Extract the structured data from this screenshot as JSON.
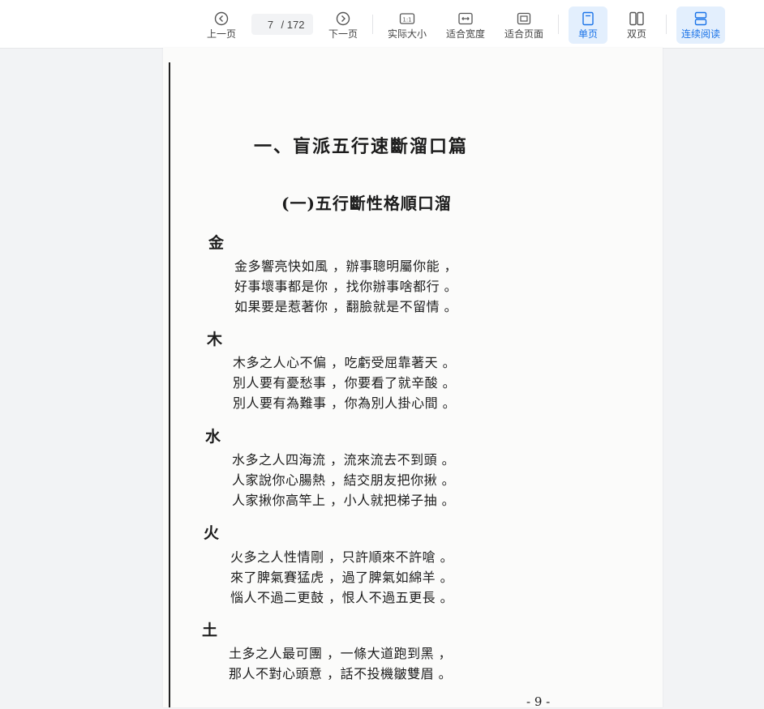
{
  "toolbar": {
    "prev_label": "上一页",
    "next_label": "下一页",
    "current_page": "7",
    "total_pages": "/ 172",
    "actual_size_label": "实际大小",
    "fit_width_label": "适合宽度",
    "fit_page_label": "适合页面",
    "single_page_label": "单页",
    "double_page_label": "双页",
    "continuous_label": "连续阅读",
    "accent_color": "#1a73e8"
  },
  "document": {
    "title": "一、盲派五行速斷溜口篇",
    "subtitle": "(一)五行斷性格順口溜",
    "sections": [
      {
        "heading": "金",
        "lines": [
          "金多響亮快如風 ，辦事聰明屬你能 ，",
          "好事壞事都是你 ，找你辦事啥都行 。",
          "如果要是惹著你 ，翻臉就是不留情 。"
        ]
      },
      {
        "heading": "木",
        "lines": [
          "木多之人心不偏 ，吃虧受屈靠著天 。",
          "別人要有憂愁事 ，你要看了就辛酸 。",
          "別人要有為難事 ，你為別人掛心間 。"
        ]
      },
      {
        "heading": "水",
        "lines": [
          "水多之人四海流 ，流來流去不到頭 。",
          "人家說你心腸熱 ，結交朋友把你揪 。",
          "人家揪你高竿上 ，小人就把梯子抽 。"
        ]
      },
      {
        "heading": "火",
        "lines": [
          "火多之人性情剛 ，只許順來不許嗆 。",
          "來了脾氣賽猛虎 ，過了脾氣如綿羊 。",
          "惱人不過二更鼓 ，恨人不過五更長 。"
        ]
      },
      {
        "heading": "土",
        "lines": [
          "土多之人最可團 ，一條大道跑到黑 ，",
          "那人不對心頭意 ，話不投機皺雙眉 。"
        ]
      }
    ],
    "page_number": "- 9 -"
  }
}
